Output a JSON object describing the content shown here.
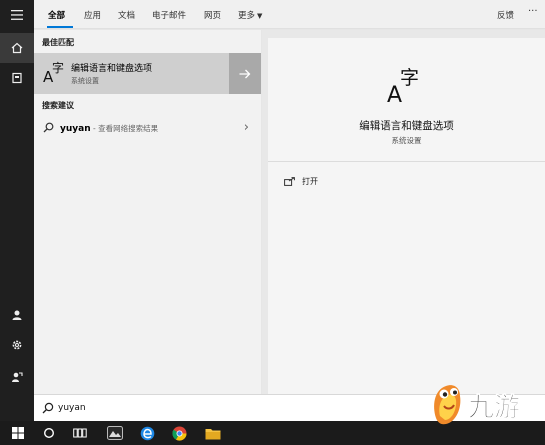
{
  "tabs": {
    "items": [
      {
        "label": "全部",
        "active": true
      },
      {
        "label": "应用"
      },
      {
        "label": "文档"
      },
      {
        "label": "电子邮件"
      },
      {
        "label": "网页"
      },
      {
        "label": "更多"
      }
    ],
    "feedback": "反馈",
    "more_menu": "···"
  },
  "results": {
    "best_match_header": "最佳匹配",
    "best": {
      "title": "编辑语言和键盘选项",
      "subtitle": "系统设置",
      "glyph_letter": "A",
      "glyph_char": "字"
    },
    "suggestions_header": "搜索建议",
    "suggestion": {
      "query": "yuyan",
      "description": " - 查看网络搜索结果"
    }
  },
  "preview": {
    "title": "编辑语言和键盘选项",
    "subtitle": "系统设置",
    "open_label": "打开"
  },
  "search": {
    "value": "yuyan"
  },
  "rail": {
    "icons": [
      "hamburger-icon",
      "home-icon",
      "document-icon",
      "user-icon",
      "gear-icon",
      "feedback-icon"
    ]
  },
  "taskbar": {
    "icons": [
      "windows-start-icon",
      "cortana-icon",
      "task-view-icon",
      "app-icon",
      "edge-icon",
      "chrome-icon",
      "file-explorer-icon"
    ]
  },
  "watermark": {
    "text": "九游"
  },
  "colors": {
    "accent": "#0078d7",
    "selected": "#cfcfcf",
    "rail": "#1f1f1f"
  }
}
